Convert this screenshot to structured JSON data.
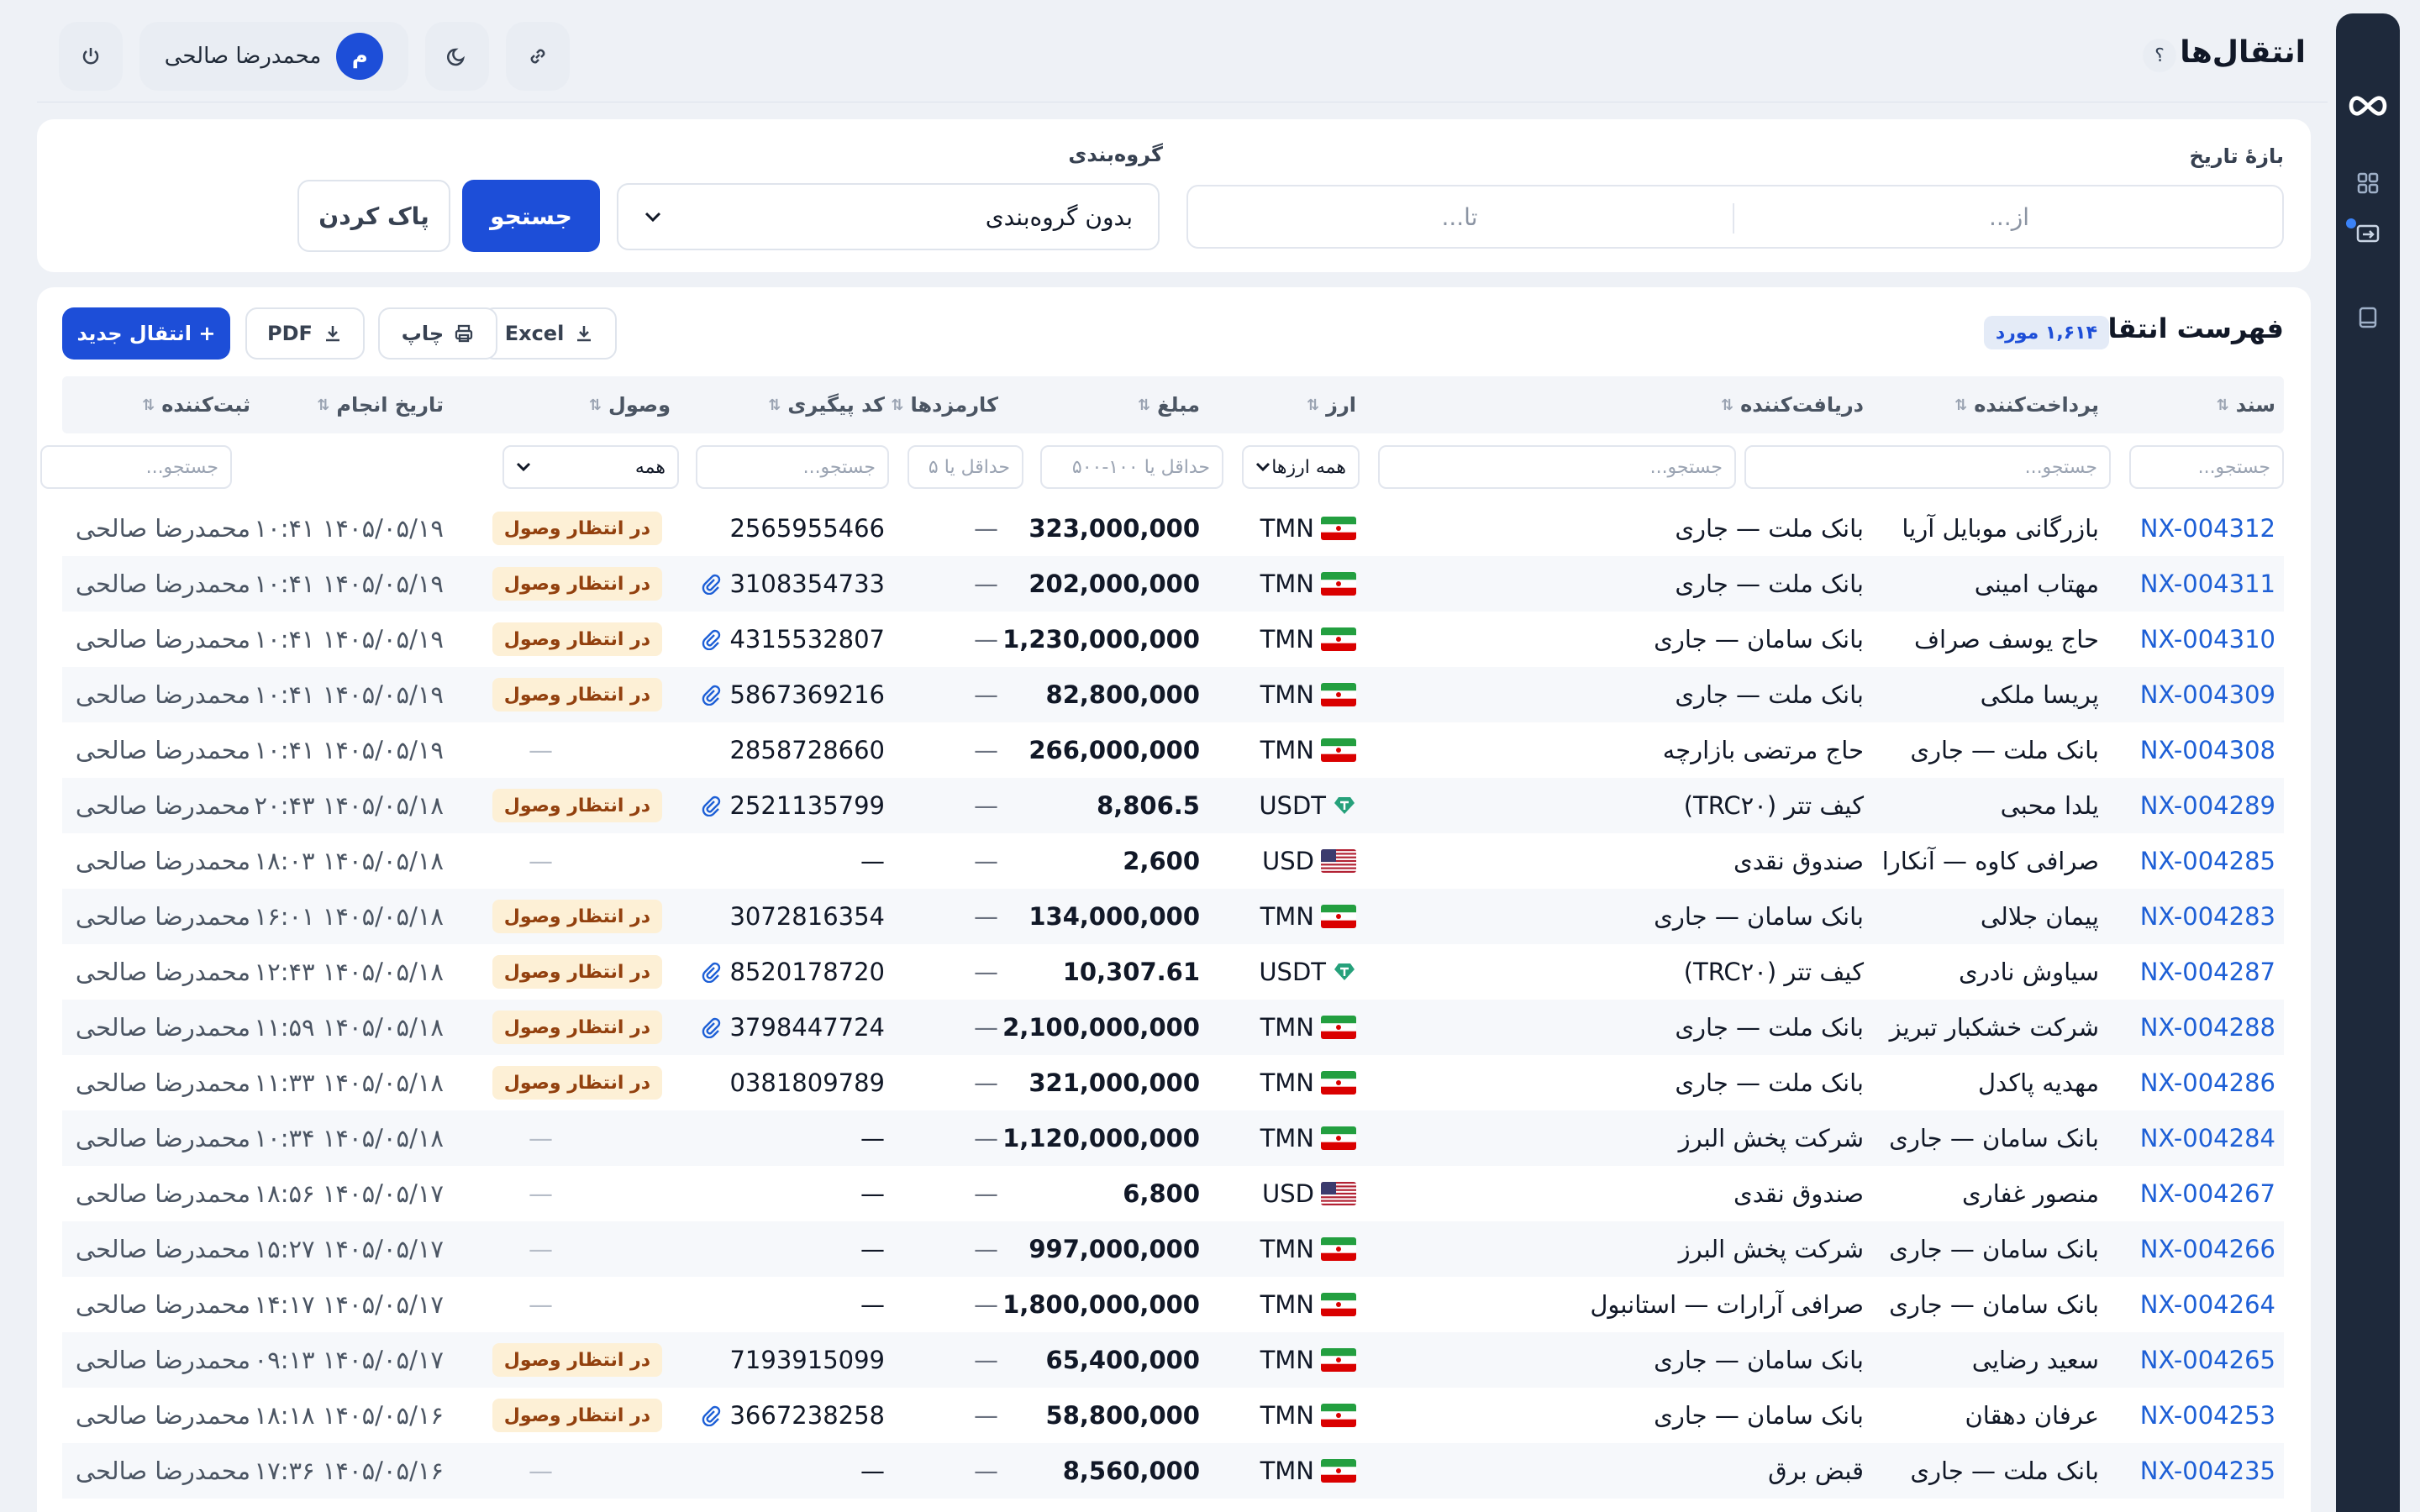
{
  "header": {
    "title": "انتقال‌ها",
    "help_label": "؟",
    "user": {
      "name": "محمدرضا صالحی",
      "initial": "م"
    }
  },
  "filters": {
    "date_label": "بازهٔ تاریخ",
    "date_from_placeholder": "از...",
    "date_to_placeholder": "تا...",
    "group_label": "گروه‌بندی",
    "group_value": "بدون گروه‌بندی",
    "search_button": "جستجو",
    "clear_button": "پاک کردن"
  },
  "list": {
    "title": "فهرست انتقال‌ها",
    "count_badge": "۱,۶۱۴ مورد",
    "excel_label": "Excel",
    "print_label": "چاپ",
    "pdf_label": "PDF",
    "new_label": "+ انتقال جدید"
  },
  "table": {
    "columns": [
      "سند",
      "پرداخت‌کننده",
      "دریافت‌کننده",
      "ارز",
      "مبلغ",
      "کارمزدها",
      "کد پیگیری",
      "وصول",
      "تاریخ انجام",
      "ثبت‌کننده"
    ],
    "filters": {
      "search_placeholder": "جستجو...",
      "currency_all": "همه ارزها",
      "amount_placeholder": "حداقل یا ۱۰۰-۵۰۰",
      "fee_placeholder": "حداقل یا ۵",
      "status_all": "همه"
    },
    "rows": [
      {
        "doc": "NX-004312",
        "payer": "بازرگانی موبایل آریا",
        "payee": "بانک ملت — جاری",
        "cur": "TMN",
        "amount": "323,000,000",
        "fee": "—",
        "tracking": "2565955466",
        "attach": false,
        "status": "در انتظار وصول",
        "date": "۱۴۰۵/۰۵/۱۹ ۱۰:۴۱",
        "by": "محمدرضا صالحی"
      },
      {
        "doc": "NX-004311",
        "payer": "مهتاب امینی",
        "payee": "بانک ملت — جاری",
        "cur": "TMN",
        "amount": "202,000,000",
        "fee": "—",
        "tracking": "3108354733",
        "attach": true,
        "status": "در انتظار وصول",
        "date": "۱۴۰۵/۰۵/۱۹ ۱۰:۴۱",
        "by": "محمدرضا صالحی"
      },
      {
        "doc": "NX-004310",
        "payer": "حاج یوسف صراف",
        "payee": "بانک سامان — جاری",
        "cur": "TMN",
        "amount": "1,230,000,000",
        "fee": "—",
        "tracking": "4315532807",
        "attach": true,
        "status": "در انتظار وصول",
        "date": "۱۴۰۵/۰۵/۱۹ ۱۰:۴۱",
        "by": "محمدرضا صالحی"
      },
      {
        "doc": "NX-004309",
        "payer": "پریسا ملکی",
        "payee": "بانک ملت — جاری",
        "cur": "TMN",
        "amount": "82,800,000",
        "fee": "—",
        "tracking": "5867369216",
        "attach": true,
        "status": "در انتظار وصول",
        "date": "۱۴۰۵/۰۵/۱۹ ۱۰:۴۱",
        "by": "محمدرضا صالحی"
      },
      {
        "doc": "NX-004308",
        "payer": "بانک ملت — جاری",
        "payee": "حاج مرتضی بازارچه",
        "cur": "TMN",
        "amount": "266,000,000",
        "fee": "—",
        "tracking": "2858728660",
        "attach": false,
        "status": "—",
        "date": "۱۴۰۵/۰۵/۱۹ ۱۰:۴۱",
        "by": "محمدرضا صالحی"
      },
      {
        "doc": "NX-004289",
        "payer": "یلدا محبی",
        "payee": "کیف تتر (TRC۲۰)",
        "cur": "USDT",
        "amount": "8,806.5",
        "fee": "—",
        "tracking": "2521135799",
        "attach": true,
        "status": "در انتظار وصول",
        "date": "۱۴۰۵/۰۵/۱۸ ۲۰:۴۳",
        "by": "محمدرضا صالحی"
      },
      {
        "doc": "NX-004285",
        "payer": "صرافی کاوه — آنکارا",
        "payee": "صندوق نقدی",
        "cur": "USD",
        "amount": "2,600",
        "fee": "—",
        "tracking": "—",
        "attach": false,
        "status": "—",
        "date": "۱۴۰۵/۰۵/۱۸ ۱۸:۰۳",
        "by": "محمدرضا صالحی"
      },
      {
        "doc": "NX-004283",
        "payer": "پیمان جلالی",
        "payee": "بانک سامان — جاری",
        "cur": "TMN",
        "amount": "134,000,000",
        "fee": "—",
        "tracking": "3072816354",
        "attach": false,
        "status": "در انتظار وصول",
        "date": "۱۴۰۵/۰۵/۱۸ ۱۶:۰۱",
        "by": "محمدرضا صالحی"
      },
      {
        "doc": "NX-004287",
        "payer": "سیاوش نادری",
        "payee": "کیف تتر (TRC۲۰)",
        "cur": "USDT",
        "amount": "10,307.61",
        "fee": "—",
        "tracking": "8520178720",
        "attach": true,
        "status": "در انتظار وصول",
        "date": "۱۴۰۵/۰۵/۱۸ ۱۲:۴۳",
        "by": "محمدرضا صالحی"
      },
      {
        "doc": "NX-004288",
        "payer": "شرکت خشکبار تبریز",
        "payee": "بانک ملت — جاری",
        "cur": "TMN",
        "amount": "2,100,000,000",
        "fee": "—",
        "tracking": "3798447724",
        "attach": true,
        "status": "در انتظار وصول",
        "date": "۱۴۰۵/۰۵/۱۸ ۱۱:۵۹",
        "by": "محمدرضا صالحی"
      },
      {
        "doc": "NX-004286",
        "payer": "مهدیه پاکدل",
        "payee": "بانک ملت — جاری",
        "cur": "TMN",
        "amount": "321,000,000",
        "fee": "—",
        "tracking": "0381809789",
        "attach": false,
        "status": "در انتظار وصول",
        "date": "۱۴۰۵/۰۵/۱۸ ۱۱:۳۳",
        "by": "محمدرضا صالحی"
      },
      {
        "doc": "NX-004284",
        "payer": "بانک سامان — جاری",
        "payee": "شرکت پخش البرز",
        "cur": "TMN",
        "amount": "1,120,000,000",
        "fee": "—",
        "tracking": "—",
        "attach": false,
        "status": "—",
        "date": "۱۴۰۵/۰۵/۱۸ ۱۰:۳۴",
        "by": "محمدرضا صالحی"
      },
      {
        "doc": "NX-004267",
        "payer": "منصور غفاری",
        "payee": "صندوق نقدی",
        "cur": "USD",
        "amount": "6,800",
        "fee": "—",
        "tracking": "—",
        "attach": false,
        "status": "—",
        "date": "۱۴۰۵/۰۵/۱۷ ۱۸:۵۶",
        "by": "محمدرضا صالحی"
      },
      {
        "doc": "NX-004266",
        "payer": "بانک سامان — جاری",
        "payee": "شرکت پخش البرز",
        "cur": "TMN",
        "amount": "997,000,000",
        "fee": "—",
        "tracking": "—",
        "attach": false,
        "status": "—",
        "date": "۱۴۰۵/۰۵/۱۷ ۱۵:۲۷",
        "by": "محمدرضا صالحی"
      },
      {
        "doc": "NX-004264",
        "payer": "بانک سامان — جاری",
        "payee": "صرافی آرارات — استانبول",
        "cur": "TMN",
        "amount": "1,800,000,000",
        "fee": "—",
        "tracking": "—",
        "attach": false,
        "status": "—",
        "date": "۱۴۰۵/۰۵/۱۷ ۱۴:۱۷",
        "by": "محمدرضا صالحی"
      },
      {
        "doc": "NX-004265",
        "payer": "سعید رضایی",
        "payee": "بانک سامان — جاری",
        "cur": "TMN",
        "amount": "65,400,000",
        "fee": "—",
        "tracking": "7193915099",
        "attach": false,
        "status": "در انتظار وصول",
        "date": "۱۴۰۵/۰۵/۱۷ ۰۹:۱۳",
        "by": "محمدرضا صالحی"
      },
      {
        "doc": "NX-004253",
        "payer": "عرفان دهقان",
        "payee": "بانک سامان — جاری",
        "cur": "TMN",
        "amount": "58,800,000",
        "fee": "—",
        "tracking": "3667238258",
        "attach": true,
        "status": "در انتظار وصول",
        "date": "۱۴۰۵/۰۵/۱۶ ۱۸:۱۸",
        "by": "محمدرضا صالحی"
      },
      {
        "doc": "NX-004235",
        "payer": "بانک ملت — جاری",
        "payee": "قبض برق",
        "cur": "TMN",
        "amount": "8,560,000",
        "fee": "—",
        "tracking": "—",
        "attach": false,
        "status": "—",
        "date": "۱۴۰۵/۰۵/۱۶ ۱۷:۳۶",
        "by": "محمدرضا صالحی"
      }
    ]
  },
  "icons": {
    "rail": [
      "infinity-logo-icon",
      "dashboard-grid-icon",
      "transfer-icon",
      "book-icon"
    ],
    "topbar": [
      "power-icon",
      "moon-icon",
      "link-icon"
    ],
    "sort": "sort-arrows-icon",
    "attach": "paperclip-icon"
  },
  "colors": {
    "primary": "#1d4ed8",
    "rail": "#1e293b",
    "link": "#1d5fd6",
    "badge_bg": "#fdf0d6",
    "badge_text": "#92400e"
  }
}
